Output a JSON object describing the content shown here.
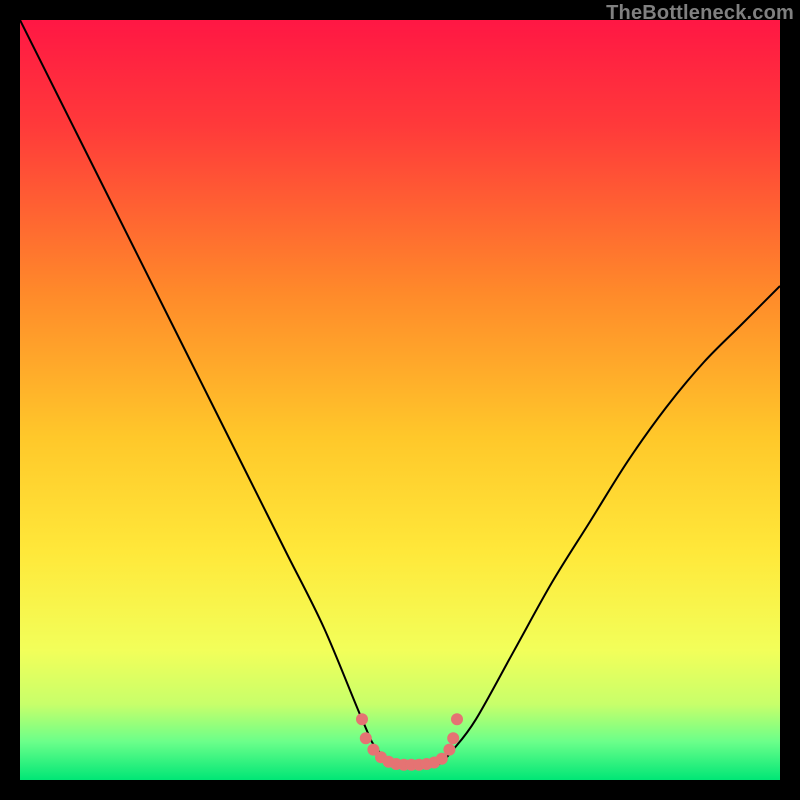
{
  "watermark": "TheBottleneck.com",
  "chart_data": {
    "type": "line",
    "title": "",
    "xlabel": "",
    "ylabel": "",
    "xlim": [
      0,
      100
    ],
    "ylim": [
      0,
      100
    ],
    "grid": false,
    "legend": false,
    "annotations": [],
    "background_gradient_stops": [
      {
        "offset": 0,
        "color": "#FF1744"
      },
      {
        "offset": 0.14,
        "color": "#FF3A3A"
      },
      {
        "offset": 0.36,
        "color": "#FF8A2A"
      },
      {
        "offset": 0.55,
        "color": "#FFC82A"
      },
      {
        "offset": 0.7,
        "color": "#FFE83A"
      },
      {
        "offset": 0.83,
        "color": "#F2FF5A"
      },
      {
        "offset": 0.9,
        "color": "#C8FF6A"
      },
      {
        "offset": 0.95,
        "color": "#6AFF8A"
      },
      {
        "offset": 1.0,
        "color": "#00E676"
      }
    ],
    "series": [
      {
        "name": "bottleneck-curve",
        "color": "#000000",
        "x": [
          0,
          5,
          10,
          15,
          20,
          25,
          30,
          35,
          40,
          45,
          47,
          50,
          53,
          55,
          57,
          60,
          65,
          70,
          75,
          80,
          85,
          90,
          95,
          100
        ],
        "y": [
          100,
          90,
          80,
          70,
          60,
          50,
          40,
          30,
          20,
          8,
          4,
          2,
          2,
          2,
          4,
          8,
          17,
          26,
          34,
          42,
          49,
          55,
          60,
          65
        ]
      }
    ],
    "markers": {
      "name": "valley-points",
      "color": "#E57373",
      "radius": 6,
      "points": [
        {
          "x": 45.0,
          "y": 8.0
        },
        {
          "x": 45.5,
          "y": 5.5
        },
        {
          "x": 46.5,
          "y": 4.0
        },
        {
          "x": 47.5,
          "y": 3.0
        },
        {
          "x": 48.5,
          "y": 2.4
        },
        {
          "x": 49.5,
          "y": 2.1
        },
        {
          "x": 50.5,
          "y": 2.0
        },
        {
          "x": 51.5,
          "y": 2.0
        },
        {
          "x": 52.5,
          "y": 2.0
        },
        {
          "x": 53.5,
          "y": 2.1
        },
        {
          "x": 54.5,
          "y": 2.3
        },
        {
          "x": 55.5,
          "y": 2.8
        },
        {
          "x": 56.5,
          "y": 4.0
        },
        {
          "x": 57.0,
          "y": 5.5
        },
        {
          "x": 57.5,
          "y": 8.0
        }
      ]
    }
  }
}
